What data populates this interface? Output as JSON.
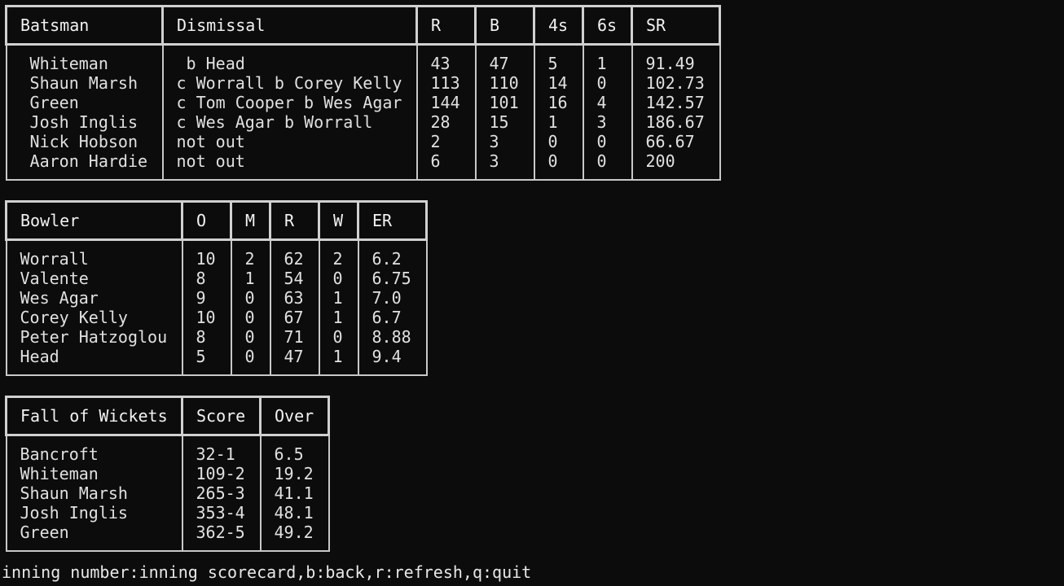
{
  "batting": {
    "headers": [
      "Batsman",
      "Dismissal",
      "R",
      "B",
      "4s",
      "6s",
      "SR"
    ],
    "rows": [
      [
        " Whiteman",
        " b Head",
        "43",
        "47",
        "5",
        "1",
        "91.49"
      ],
      [
        " Shaun Marsh",
        "c Worrall b Corey Kelly",
        "113",
        "110",
        "14",
        "0",
        "102.73"
      ],
      [
        " Green",
        "c Tom Cooper b Wes Agar",
        "144",
        "101",
        "16",
        "4",
        "142.57"
      ],
      [
        " Josh Inglis",
        "c Wes Agar b Worrall",
        "28",
        "15",
        "1",
        "3",
        "186.67"
      ],
      [
        " Nick Hobson",
        "not out",
        "2",
        "3",
        "0",
        "0",
        "66.67"
      ],
      [
        " Aaron Hardie",
        "not out",
        "6",
        "3",
        "0",
        "0",
        "200"
      ]
    ]
  },
  "bowling": {
    "headers": [
      "Bowler",
      "O",
      "M",
      "R",
      "W",
      "ER"
    ],
    "rows": [
      [
        "Worrall",
        "10",
        "2",
        "62",
        "2",
        "6.2"
      ],
      [
        "Valente",
        "8",
        "1",
        "54",
        "0",
        "6.75"
      ],
      [
        "Wes Agar",
        "9",
        "0",
        "63",
        "1",
        "7.0"
      ],
      [
        "Corey Kelly",
        "10",
        "0",
        "67",
        "1",
        "6.7"
      ],
      [
        "Peter Hatzoglou",
        "8",
        "0",
        "71",
        "0",
        "8.88"
      ],
      [
        "Head",
        "5",
        "0",
        "47",
        "1",
        "9.4"
      ]
    ]
  },
  "fall_of_wickets": {
    "headers": [
      "Fall of Wickets",
      "Score",
      "Over"
    ],
    "rows": [
      [
        "Bancroft",
        "32-1",
        "6.5"
      ],
      [
        "Whiteman",
        "109-2",
        "19.2"
      ],
      [
        "Shaun Marsh",
        "265-3",
        "41.1"
      ],
      [
        "Josh Inglis",
        "353-4",
        "48.1"
      ],
      [
        "Green",
        "362-5",
        "49.2"
      ]
    ]
  },
  "status_line": "inning number:inning scorecard,b:back,r:refresh,q:quit"
}
